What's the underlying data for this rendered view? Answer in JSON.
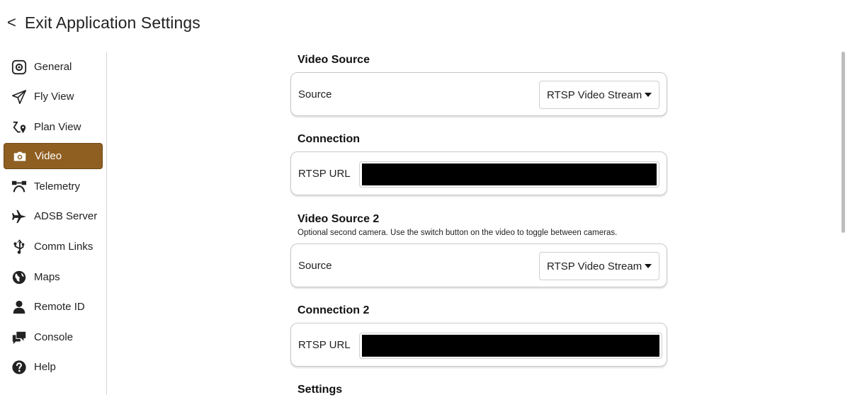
{
  "header": {
    "back_symbol": "<",
    "title": "Exit Application Settings"
  },
  "sidebar": {
    "items": [
      {
        "label": "General",
        "icon": "gear-icon"
      },
      {
        "label": "Fly View",
        "icon": "paper-plane-icon"
      },
      {
        "label": "Plan View",
        "icon": "route-icon"
      },
      {
        "label": "Video",
        "icon": "camera-icon",
        "active": true
      },
      {
        "label": "Telemetry",
        "icon": "telemetry-icon"
      },
      {
        "label": "ADSB Server",
        "icon": "airplane-icon"
      },
      {
        "label": "Comm Links",
        "icon": "usb-icon"
      },
      {
        "label": "Maps",
        "icon": "globe-icon"
      },
      {
        "label": "Remote ID",
        "icon": "person-icon"
      },
      {
        "label": "Console",
        "icon": "chat-icon"
      },
      {
        "label": "Help",
        "icon": "question-icon"
      }
    ],
    "active_color": "#8f5f22"
  },
  "main": {
    "video_source": {
      "title": "Video Source",
      "source_label": "Source",
      "source_value": "RTSP Video Stream"
    },
    "connection": {
      "title": "Connection",
      "url_label": "RTSP URL",
      "url_value": ""
    },
    "video_source_2": {
      "title": "Video Source 2",
      "description": "Optional second camera. Use the switch button on the video to toggle between cameras.",
      "source_label": "Source",
      "source_value": "RTSP Video Stream"
    },
    "connection_2": {
      "title": "Connection 2",
      "url_label": "RTSP URL",
      "url_value": ""
    },
    "settings": {
      "title": "Settings"
    }
  }
}
